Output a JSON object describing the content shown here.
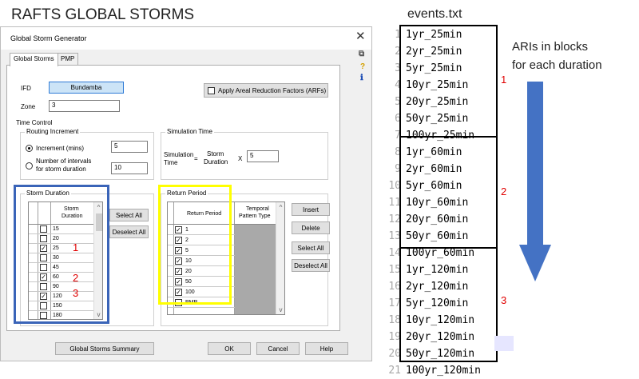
{
  "page_title": "RAFTS GLOBAL STORMS",
  "dialog": {
    "title": "Global Storm Generator",
    "close": "✕",
    "tabs": [
      "Global Storms",
      "PMP"
    ],
    "ifd_label": "IFD",
    "ifd_button": "Bundamba",
    "arf_label": "Apply Areal Reduction Factors (ARFs)",
    "zone_label": "Zone",
    "zone_value": "3",
    "time_control": "Time Control",
    "routing_increment": "Routing Increment",
    "increment_label": "Increment (mins)",
    "increment_value": "5",
    "intervals_label_1": "Number of intervals",
    "intervals_label_2": "for storm duration",
    "intervals_value": "10",
    "simulation_time": "Simulation Time",
    "sim_label_1": "Simulation",
    "sim_label_2": "Time",
    "equals": "=",
    "storm_label_1": "Storm",
    "storm_label_2": "Duration",
    "x_label": "X",
    "sim_value": "5",
    "storm_duration_group": "Storm Duration",
    "storm_duration_header_1": "Storm",
    "storm_duration_header_2": "Duration",
    "durations": [
      {
        "value": "15",
        "checked": false
      },
      {
        "value": "20",
        "checked": false
      },
      {
        "value": "25",
        "checked": true
      },
      {
        "value": "30",
        "checked": false
      },
      {
        "value": "45",
        "checked": false
      },
      {
        "value": "60",
        "checked": true
      },
      {
        "value": "90",
        "checked": false
      },
      {
        "value": "120",
        "checked": true
      },
      {
        "value": "150",
        "checked": false
      },
      {
        "value": "180",
        "checked": false
      }
    ],
    "select_all": "Select All",
    "deselect_all": "Deselect All",
    "return_period_group": "Return Period",
    "return_period_header": "Return Period",
    "temporal_header_1": "Temporal",
    "temporal_header_2": "Pattern Type",
    "return_periods": [
      {
        "value": "1",
        "checked": true
      },
      {
        "value": "2",
        "checked": true
      },
      {
        "value": "5",
        "checked": true
      },
      {
        "value": "10",
        "checked": true
      },
      {
        "value": "20",
        "checked": true
      },
      {
        "value": "50",
        "checked": true
      },
      {
        "value": "100",
        "checked": true
      },
      {
        "value": "PMP",
        "checked": false
      }
    ],
    "insert": "Insert",
    "delete": "Delete",
    "rp_select_all": "Select All",
    "rp_deselect_all": "Deselect All",
    "summary_button": "Global Storms Summary",
    "ok": "OK",
    "cancel": "Cancel",
    "help": "Help",
    "check_mark": "✓",
    "scroll_up": "^",
    "scroll_down": "v"
  },
  "annotations": {
    "durations": [
      "1",
      "2",
      "3"
    ],
    "blocks": [
      "1",
      "2",
      "3"
    ]
  },
  "side_icons": [
    "⧉",
    "?",
    "ℹ"
  ],
  "events": {
    "filename": "events.txt",
    "lines": [
      "1yr_25min",
      "2yr_25min",
      "5yr_25min",
      "10yr_25min",
      "20yr_25min",
      "50yr_25min",
      "100yr_25min",
      "1yr_60min",
      "2yr_60min",
      "5yr_60min",
      "10yr_60min",
      "20yr_60min",
      "50yr_60min",
      "100yr_60min",
      "1yr_120min",
      "2yr_120min",
      "5yr_120min",
      "10yr_120min",
      "20yr_120min",
      "50yr_120min",
      "100yr_120min"
    ],
    "line_numbers": [
      "1",
      "2",
      "3",
      "4",
      "5",
      "6",
      "7",
      "8",
      "9",
      "10",
      "11",
      "12",
      "13",
      "14",
      "15",
      "16",
      "17",
      "18",
      "19",
      "20",
      "21"
    ]
  },
  "note": {
    "line1": "ARIs in blocks",
    "line2": "for each duration"
  },
  "colors": {
    "storm_box": "#3a64b8",
    "return_box": "#ffff00",
    "arrow": "#4472c4",
    "annotation": "#e00000"
  }
}
